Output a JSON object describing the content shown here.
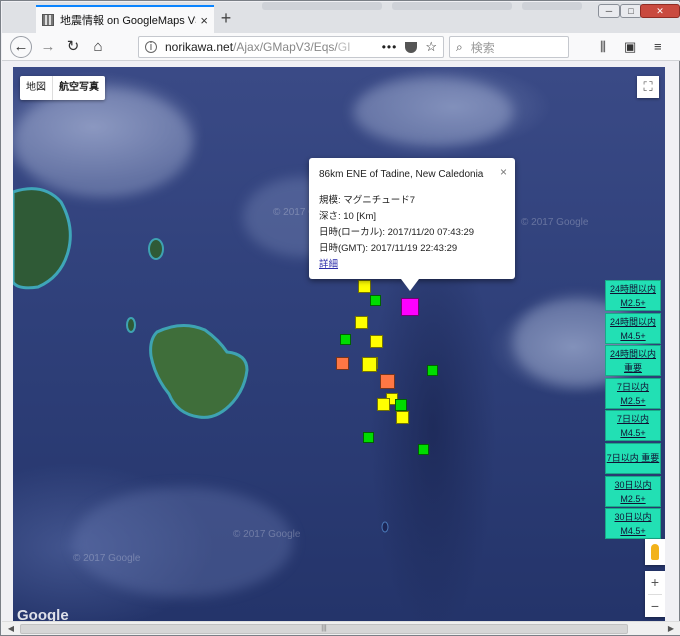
{
  "browser": {
    "tab_title": "地震情報 on GoogleMaps V3",
    "new_tab": "+",
    "close_tab": "×",
    "url_domain": "norikawa.net",
    "url_path": "/Ajax/GMapV3/Eqs/",
    "url_faded": "GI",
    "more_dots": "•••",
    "search_placeholder": "検索",
    "window_buttons": [
      "─",
      "□",
      "✕"
    ]
  },
  "map": {
    "map_type_options": [
      "地図",
      "航空写真"
    ],
    "selected_map_type": "航空写真",
    "watermark": "© 2017 Google",
    "google_logo": "Google",
    "zoom_in": "+",
    "zoom_out": "−",
    "markers": [
      {
        "color": "#ffff00",
        "magnitude_class": "M2.5+"
      },
      {
        "color": "#00dd00",
        "magnitude_class": "M2.5+"
      },
      {
        "color": "#ff00ff",
        "magnitude_class": "selected"
      },
      {
        "color": "#ffff00"
      },
      {
        "color": "#00dd00"
      },
      {
        "color": "#ffff00"
      },
      {
        "color": "#ffff00"
      },
      {
        "color": "#ff7744"
      },
      {
        "color": "#ffff00"
      },
      {
        "color": "#00dd00"
      },
      {
        "color": "#ff7744"
      },
      {
        "color": "#ffff00"
      },
      {
        "color": "#ffff00"
      },
      {
        "color": "#00dd00"
      },
      {
        "color": "#ffff00"
      },
      {
        "color": "#00dd00"
      },
      {
        "color": "#00dd00"
      }
    ]
  },
  "info_window": {
    "title": "86km ENE of Tadine, New Caledonia",
    "close": "×",
    "magnitude": "規模: マグニチュード7",
    "depth": "深さ: 10 [Km]",
    "local_time": "日時(ローカル): 2017/11/20 07:43:29",
    "gmt_time": "日時(GMT): 2017/11/19 22:43:29",
    "detail_link": "詳細"
  },
  "side_buttons": [
    {
      "line1": "24時間以内",
      "line2": "M2.5+"
    },
    {
      "line1": "24時間以内",
      "line2": "M4.5+"
    },
    {
      "line1": "24時間以内",
      "line2": "重要"
    },
    {
      "line1": "7日以内",
      "line2": "M2.5+"
    },
    {
      "line1": "7日以内",
      "line2": "M4.5+"
    },
    {
      "line1": "7日以内 重要",
      "line2": ""
    },
    {
      "line1": "30日以内",
      "line2": "M2.5+"
    },
    {
      "line1": "30日以内",
      "line2": "M4.5+"
    }
  ],
  "colors": {
    "accent_tab": "#0a84ff",
    "side_button_bg": "#22e0b4",
    "link": "#2a2aa8"
  },
  "scrollbar": {
    "thumb_label": "|||"
  }
}
